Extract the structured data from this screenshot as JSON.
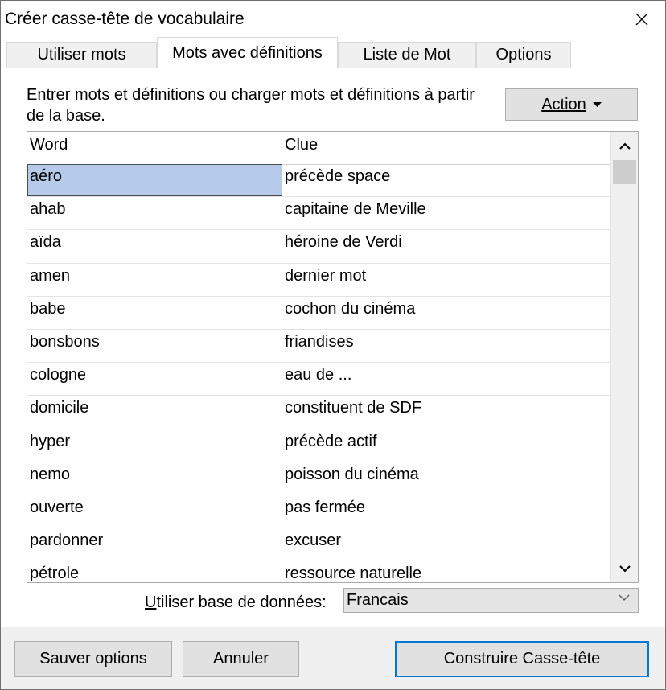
{
  "window": {
    "title": "Créer casse-tête de vocabulaire"
  },
  "tabs": [
    {
      "label": "Utiliser mots",
      "active": false
    },
    {
      "label": "Mots avec définitions",
      "active": true
    },
    {
      "label": "Liste de Mot",
      "active": false
    },
    {
      "label": "Options",
      "active": false
    }
  ],
  "panel": {
    "instructions": "Entrer mots et définitions ou charger mots et définitions à partir de la base.",
    "action_button": {
      "label": "Action",
      "icon": "caret-down-icon"
    }
  },
  "grid": {
    "columns": [
      "Word",
      "Clue"
    ],
    "rows": [
      {
        "word": "aéro",
        "clue": "précède space",
        "selected": true
      },
      {
        "word": "ahab",
        "clue": "capitaine de Meville"
      },
      {
        "word": "aïda",
        "clue": "héroine de Verdi"
      },
      {
        "word": "amen",
        "clue": "dernier mot"
      },
      {
        "word": "babe",
        "clue": "cochon du cinéma"
      },
      {
        "word": "bonsbons",
        "clue": "friandises"
      },
      {
        "word": "cologne",
        "clue": "eau de ..."
      },
      {
        "word": "domicile",
        "clue": "constituent de SDF"
      },
      {
        "word": "hyper",
        "clue": "précède actif"
      },
      {
        "word": "nemo",
        "clue": "poisson du cinéma"
      },
      {
        "word": "ouverte",
        "clue": "pas fermée"
      },
      {
        "word": "pardonner",
        "clue": "excuser"
      },
      {
        "word": "pétrole",
        "clue": "ressource naturelle"
      }
    ]
  },
  "database": {
    "label": "Utiliser base de données:",
    "selected": "Francais"
  },
  "buttons": {
    "save_options": "Sauver options",
    "cancel": "Annuler",
    "build": "Construire Casse-tête"
  },
  "colors": {
    "selection": "#b6cbea",
    "primary_border": "#0078d7"
  }
}
